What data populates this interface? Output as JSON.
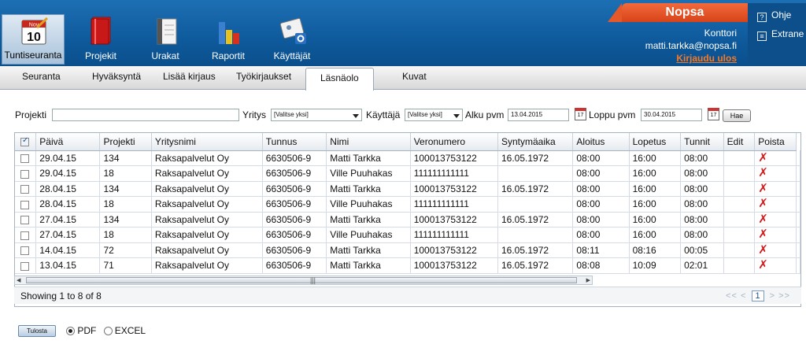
{
  "nav": [
    {
      "label": "Tuntiseuranta",
      "icon": "calendar-icon",
      "active": true
    },
    {
      "label": "Projekit",
      "icon": "folder-icon"
    },
    {
      "label": "Urakat",
      "icon": "notebook-icon"
    },
    {
      "label": "Raportit",
      "icon": "bar-chart-icon"
    },
    {
      "label": "Käyttäjät",
      "icon": "id-card-gear-icon"
    }
  ],
  "calendar_icon_text": {
    "month": "Nov",
    "day": "10"
  },
  "brand": "Nopsa",
  "user": {
    "org": "Konttori",
    "email": "matti.tarkka@nopsa.fi",
    "logout": "Kirjaudu ulos"
  },
  "help": {
    "ohje": "Ohje",
    "extranet": "Extrane"
  },
  "tabs": [
    "Seuranta",
    "Hyväksyntä",
    "Lisää kirjaus",
    "Työkirjaukset",
    "Läsnäolo",
    "Kuvat"
  ],
  "filter": {
    "projekti_label": "Projekti",
    "yritys_label": "Yritys",
    "yritys_value": "[Valitse yksi]",
    "kayttaja_label": "Käyttäjä",
    "kayttaja_value": "[Valitse yksi]",
    "alku_label": "Alku pvm",
    "alku_value": "13.04.2015",
    "loppu_label": "Loppu pvm",
    "loppu_value": "30.04.2015",
    "hae": "Hae"
  },
  "table": {
    "headers": [
      "Päivä",
      "Projekti",
      "Yritysnimi",
      "Tunnus",
      "Nimi",
      "Veronumero",
      "Syntymäaika",
      "Aloitus",
      "Lopetus",
      "Tunnit",
      "Edit",
      "Poista"
    ],
    "rows": [
      [
        "29.04.15",
        "134",
        "Raksapalvelut Oy",
        "6630506-9",
        "Matti Tarkka",
        "100013753122",
        "16.05.1972",
        "08:00",
        "16:00",
        "08:00"
      ],
      [
        "29.04.15",
        "18",
        "Raksapalvelut Oy",
        "6630506-9",
        "Ville Puuhakas",
        "111111111111",
        "",
        "08:00",
        "16:00",
        "08:00"
      ],
      [
        "28.04.15",
        "134",
        "Raksapalvelut Oy",
        "6630506-9",
        "Matti Tarkka",
        "100013753122",
        "16.05.1972",
        "08:00",
        "16:00",
        "08:00"
      ],
      [
        "28.04.15",
        "18",
        "Raksapalvelut Oy",
        "6630506-9",
        "Ville Puuhakas",
        "111111111111",
        "",
        "08:00",
        "16:00",
        "08:00"
      ],
      [
        "27.04.15",
        "134",
        "Raksapalvelut Oy",
        "6630506-9",
        "Matti Tarkka",
        "100013753122",
        "16.05.1972",
        "08:00",
        "16:00",
        "08:00"
      ],
      [
        "27.04.15",
        "18",
        "Raksapalvelut Oy",
        "6630506-9",
        "Ville Puuhakas",
        "111111111111",
        "",
        "08:00",
        "16:00",
        "08:00"
      ],
      [
        "14.04.15",
        "72",
        "Raksapalvelut Oy",
        "6630506-9",
        "Matti Tarkka",
        "100013753122",
        "16.05.1972",
        "08:11",
        "08:16",
        "00:05"
      ],
      [
        "13.04.15",
        "71",
        "Raksapalvelut Oy",
        "6630506-9",
        "Matti Tarkka",
        "100013753122",
        "16.05.1972",
        "08:08",
        "10:09",
        "02:01"
      ]
    ],
    "delete_glyph": "✗"
  },
  "pager": {
    "info": "Showing 1 to 8 of 8",
    "first": "<<",
    "prev": "<",
    "current": "1",
    "next": ">",
    "last": ">>"
  },
  "export": {
    "print": "Tulosta",
    "pdf": "PDF",
    "excel": "EXCEL"
  },
  "colors": {
    "header_blue": "#0e5a9c",
    "brand_orange": "#e4582a",
    "logout_orange": "#f07a2a",
    "delete_red": "#d21a1a"
  }
}
